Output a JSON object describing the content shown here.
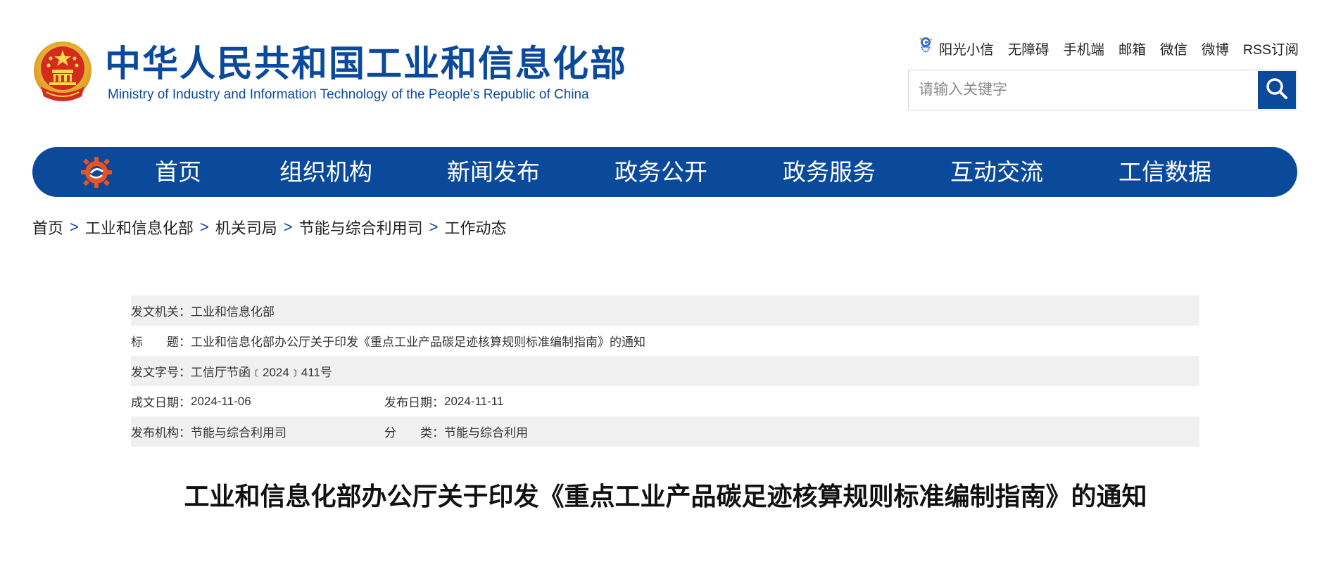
{
  "header": {
    "site_title": "中华人民共和国工业和信息化部",
    "site_subtitle": "Ministry of Industry and Information Technology of the People’s Republic of China",
    "top_links": [
      "阳光小信",
      "无障碍",
      "手机端",
      "邮箱",
      "微信",
      "微博",
      "RSS订阅"
    ],
    "search_placeholder": "请输入关键字",
    "brand_color": "#0b4a9b"
  },
  "nav": {
    "items": [
      "首页",
      "组织机构",
      "新闻发布",
      "政务公开",
      "政务服务",
      "互动交流",
      "工信数据"
    ]
  },
  "breadcrumb": {
    "items": [
      "首页",
      "工业和信息化部",
      "机关司局",
      "节能与综合利用司",
      "工作动态"
    ],
    "separator": ">"
  },
  "meta": {
    "issuer_label": "发文机关：",
    "issuer": "工业和信息化部",
    "title_label": "标　　题：",
    "title": "工业和信息化部办公厅关于印发《重点工业产品碳足迹核算规则标准编制指南》的通知",
    "doc_no_label": "发文字号：",
    "doc_no": "工信厅节函﹝2024﹞411号",
    "written_date_label": "成文日期：",
    "written_date": "2024-11-06",
    "publish_date_label": "发布日期：",
    "publish_date": "2024-11-11",
    "publisher_label": "发布机构：",
    "publisher": "节能与综合利用司",
    "category_label": "分　　类：",
    "category": "节能与综合利用"
  },
  "document": {
    "title": "工业和信息化部办公厅关于印发《重点工业产品碳足迹核算规则标准编制指南》的通知"
  }
}
